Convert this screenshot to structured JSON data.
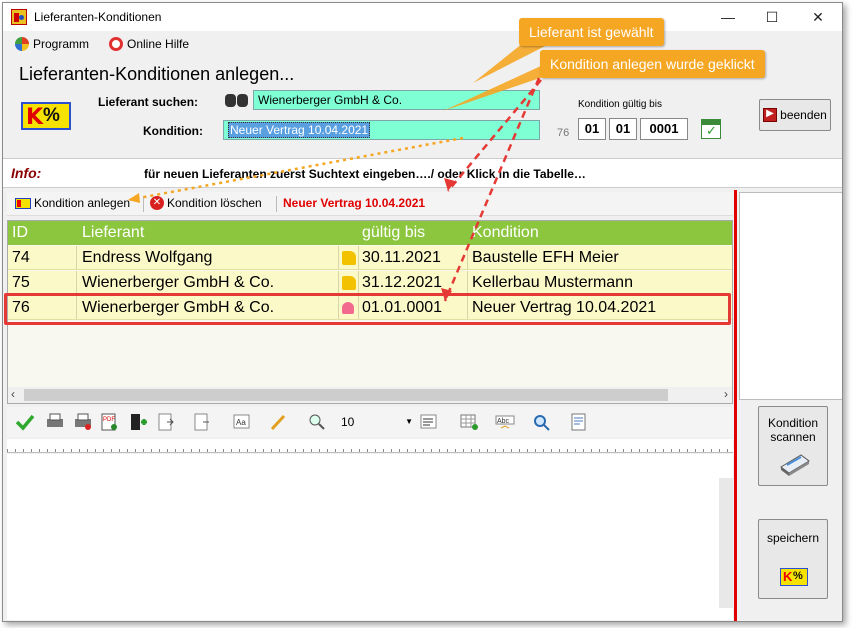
{
  "window": {
    "title": "Lieferanten-Konditionen"
  },
  "menu": {
    "program": "Programm",
    "help": "Online Hilfe"
  },
  "heading": "Lieferanten-Konditionen anlegen...",
  "form": {
    "supplier_label": "Lieferant suchen:",
    "supplier_value": "Wienerberger GmbH & Co.",
    "condition_label": "Kondition:",
    "condition_value": "Neuer Vertrag 10.04.2021",
    "validity_label": "Kondition gültig bis",
    "condition_id": "76",
    "day": "01",
    "month": "01",
    "year": "0001"
  },
  "buttons": {
    "exit": "beenden",
    "scan": "Kondition scannen",
    "save": "speichern"
  },
  "info": {
    "label": "Info:",
    "text": "für neuen Lieferanten zuerst Suchtext eingeben…./ oder Klick in die Tabelle…"
  },
  "toolbar": {
    "add": "Kondition anlegen",
    "delete": "Kondition löschen",
    "current": "Neuer Vertrag 10.04.2021",
    "font_size": "10"
  },
  "table": {
    "headers": [
      "ID",
      "Lieferant",
      "gültig bis",
      "Kondition"
    ],
    "rows": [
      {
        "id": "74",
        "supplier": "Endress Wolfgang",
        "status": "thumbs-up",
        "valid": "30.11.2021",
        "condition": "Baustelle EFH Meier"
      },
      {
        "id": "75",
        "supplier": "Wienerberger GmbH & Co.",
        "status": "thumbs-up",
        "valid": "31.12.2021",
        "condition": "Kellerbau Mustermann"
      },
      {
        "id": "76",
        "supplier": "Wienerberger GmbH & Co.",
        "status": "thumbs-down",
        "valid": "01.01.0001",
        "condition": "Neuer Vertrag 10.04.2021"
      }
    ]
  },
  "callouts": {
    "supplier_chosen": "Lieferant ist gewählt",
    "condition_clicked": "Kondition anlegen wurde geklickt"
  },
  "colors": {
    "grid_header": "#8cc63f",
    "grid_row": "#fbf9c8",
    "input_bg": "#7fffd4",
    "accent_red": "#e00000",
    "callout": "#f5a623"
  }
}
